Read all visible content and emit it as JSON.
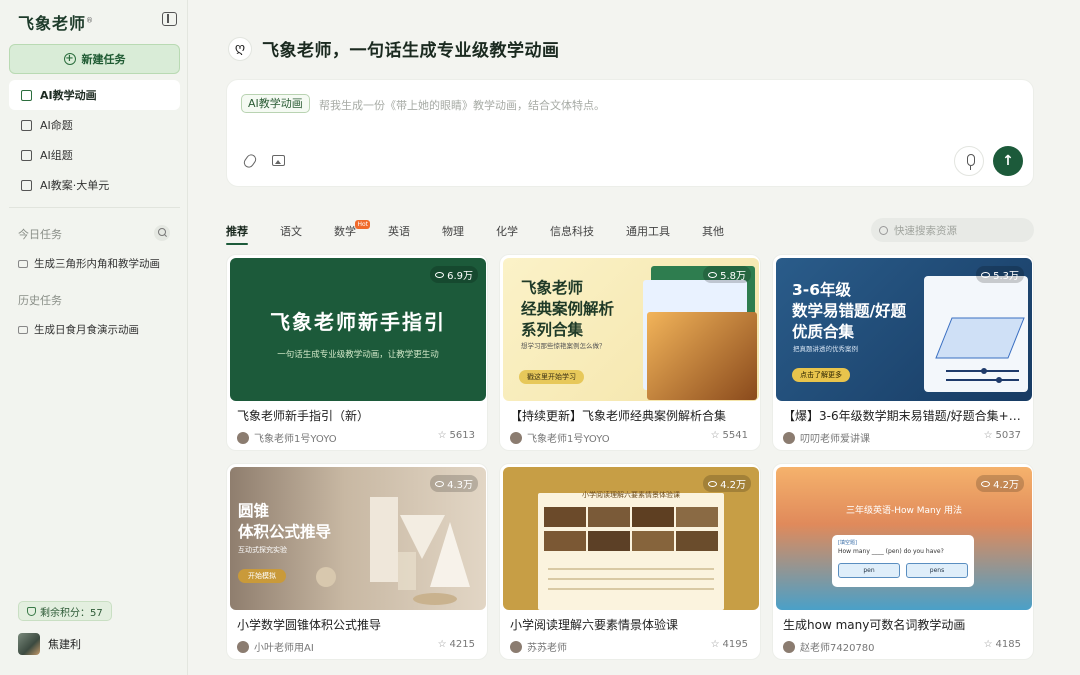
{
  "sidebar": {
    "logo": "飞象老师",
    "logo_mark": "®",
    "new_task_label": "新建任务",
    "nav": [
      {
        "label": "AI教学动画",
        "active": true
      },
      {
        "label": "AI命题",
        "active": false
      },
      {
        "label": "AI组题",
        "active": false
      },
      {
        "label": "AI教案·大单元",
        "active": false
      }
    ],
    "today_title": "今日任务",
    "today_items": [
      "生成三角形内角和教学动画"
    ],
    "history_title": "历史任务",
    "history_items": [
      "生成日食月食演示动画"
    ],
    "points_label": "剩余积分：57",
    "user_name": "焦建利"
  },
  "main": {
    "title": "飞象老师，一句话生成专业级教学动画",
    "prompt_tag": "AI教学动画",
    "prompt_placeholder": "帮我生成一份《带上她的眼睛》教学动画，结合文体特点。",
    "send_symbol": "↑",
    "tabs": [
      {
        "label": "推荐",
        "active": true
      },
      {
        "label": "语文"
      },
      {
        "label": "数学",
        "badge": "Hot"
      },
      {
        "label": "英语"
      },
      {
        "label": "物理"
      },
      {
        "label": "化学"
      },
      {
        "label": "信息科技"
      },
      {
        "label": "通用工具"
      },
      {
        "label": "其他"
      }
    ],
    "search_placeholder": "快速搜索资源"
  },
  "cards": [
    {
      "title": "飞象老师新手指引（新）",
      "views": "6.9万",
      "author": "飞象老师1号YOYO",
      "likes": "5613",
      "thumb": {
        "big": "飞象老师新手指引",
        "small": "一句话生成专业级教学动画，让教学更生动"
      }
    },
    {
      "title": "【持续更新】飞象老师经典案例解析合集",
      "views": "5.8万",
      "author": "飞象老师1号YOYO",
      "likes": "5541",
      "thumb": {
        "h1": "飞象老师",
        "h2": "经典案例解析",
        "h3": "系列合集",
        "sub": "想学习那些惊艳案例怎么做？",
        "btn": "戳这里开始学习"
      }
    },
    {
      "title": "【爆】3-6年级数学期末易错题/好题合集+…",
      "views": "5.3万",
      "author": "叨叨老师爱讲课",
      "likes": "5037",
      "thumb": {
        "h1": "3-6年级",
        "h2": "数学易错题/好题",
        "h3": "优质合集",
        "sub": "把真题讲透的优秀案例",
        "btn": "点击了解更多"
      }
    },
    {
      "title": "小学数学圆锥体积公式推导",
      "views": "4.3万",
      "author": "小叶老师用AI",
      "likes": "4215",
      "thumb": {
        "h1": "圆锥",
        "h2": "体积公式推导",
        "sub": "互动式探究实验",
        "btn": "开始模拟"
      }
    },
    {
      "title": "小学阅读理解六要素情景体验课",
      "views": "4.2万",
      "author": "苏苏老师",
      "likes": "4195",
      "thumb": {
        "ptitle": "小学阅读理解六要素情景体验课"
      }
    },
    {
      "title": "生成how many可数名词教学动画",
      "views": "4.2万",
      "author": "赵老师7420780",
      "likes": "4185",
      "thumb": {
        "ht": "三年级英语-How Many 用法",
        "lbl": "[填空题]",
        "q": "How many ____ (pen) do you have?",
        "opt1": "pen",
        "opt2": "pens"
      }
    }
  ],
  "colors": {
    "brand": "#1c5a3a",
    "accent_light": "#d9ecd7",
    "hot": "#f06a2b"
  }
}
